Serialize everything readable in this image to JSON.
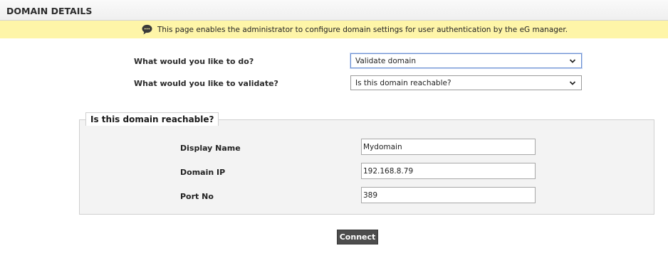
{
  "header": {
    "title": "DOMAIN DETAILS"
  },
  "info": {
    "icon": "speech-bubble-icon",
    "text": "This page enables the administrator to configure domain settings for user authentication by the eG manager."
  },
  "form": {
    "action_label": "What would you like to do?",
    "action_value": "Validate domain",
    "validate_label": "What would you like to validate?",
    "validate_value": "Is this domain reachable?"
  },
  "reachability": {
    "legend": "Is this domain reachable?",
    "fields": [
      {
        "label": "Display Name",
        "value": "Mydomain"
      },
      {
        "label": "Domain IP",
        "value": "192.168.8.79"
      },
      {
        "label": "Port No",
        "value": "389"
      }
    ]
  },
  "actions": {
    "connect_label": "Connect"
  },
  "colors": {
    "info_bar": "#fef5a8",
    "button": "#4d4d4d",
    "fieldset_bg": "#f3f3f3"
  }
}
